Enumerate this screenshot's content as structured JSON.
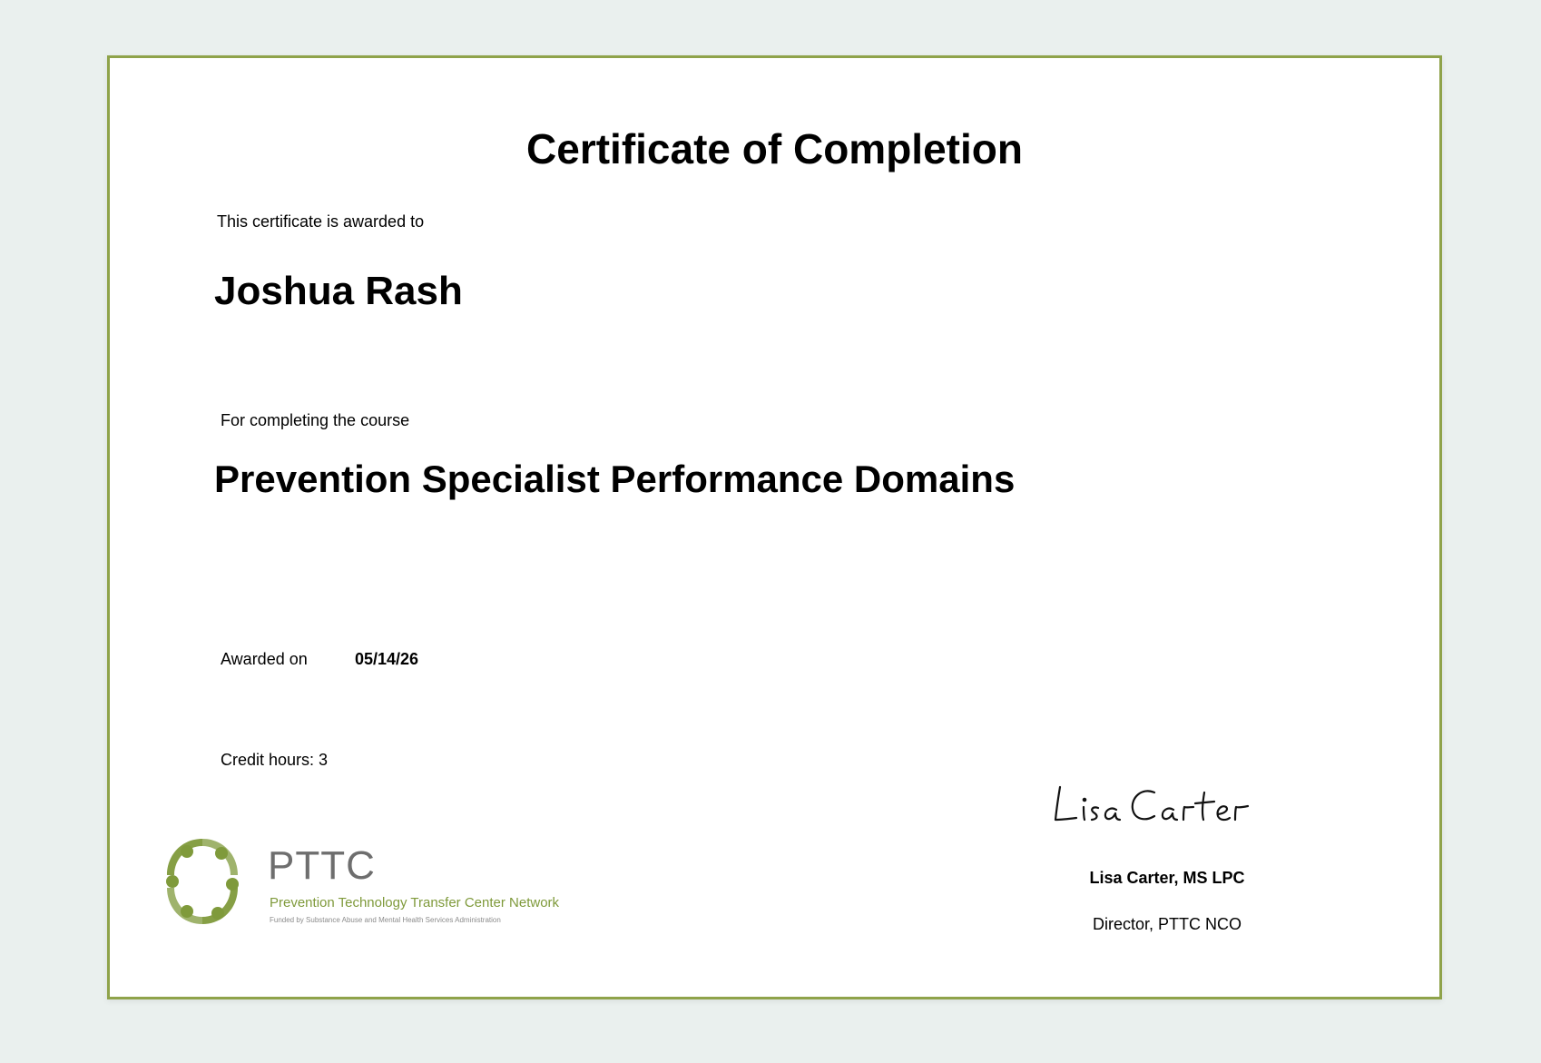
{
  "certificate": {
    "title": "Certificate of Completion",
    "awarded_to_label": "This certificate is awarded to",
    "recipient_name": "Joshua Rash",
    "course_label": "For completing the course",
    "course_name": "Prevention Specialist Performance Domains",
    "awarded_on_label": "Awarded on",
    "awarded_on_date": "05/14/26",
    "credit_hours": "Credit hours: 3"
  },
  "signatory": {
    "signature_text": "Lisa Carter",
    "name": "Lisa Carter, MS LPC",
    "title": "Director, PTTC NCO"
  },
  "logo": {
    "acronym": "PTTC",
    "network_name": "Prevention Technology Transfer Center Network",
    "funding_line": "Funded by Substance Abuse and Mental Health Services Administration",
    "mark_icon": "pttc-people-circle-logo"
  },
  "colors": {
    "border": "#8fa34a",
    "page_background": "#eaf0ee",
    "logo_green": "#7f9a3b",
    "logo_gray": "#6e6e6e"
  }
}
